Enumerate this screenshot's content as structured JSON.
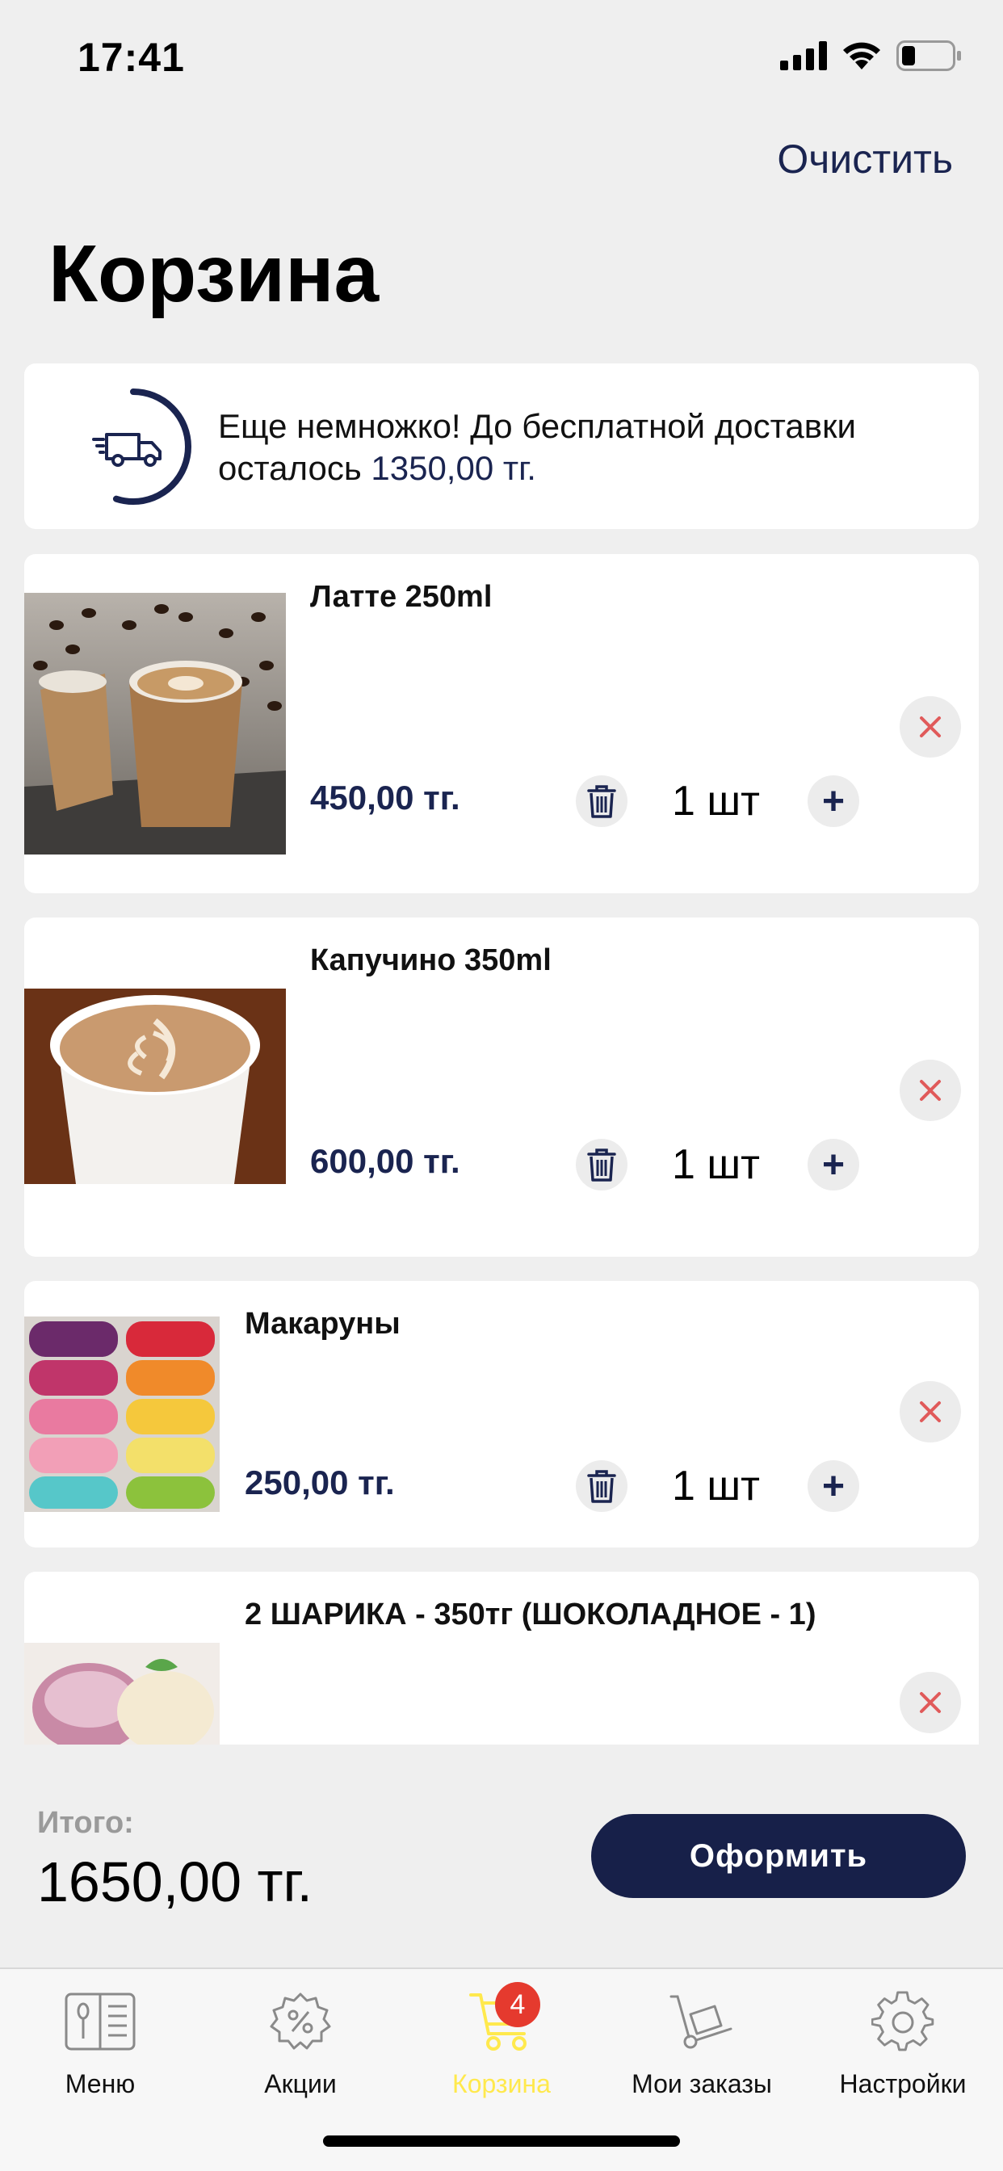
{
  "status_bar": {
    "time": "17:41"
  },
  "header": {
    "clear_label": "Очистить",
    "title": "Корзина"
  },
  "promo": {
    "line1": "Еще немножко! До бесплатной доставки",
    "line2_prefix": "осталось ",
    "amount": "1350,00 тг.",
    "progress_fraction": 0.55
  },
  "cart": {
    "items": [
      {
        "name": "Латте  250ml",
        "price": "450,00 тг.",
        "qty": "1 шт"
      },
      {
        "name": "Капучино  350ml",
        "price": "600,00 тг.",
        "qty": "1 шт"
      },
      {
        "name": "Макаруны",
        "price": "250,00 тг.",
        "qty": "1 шт"
      },
      {
        "name": "2 ШАРИКА - 350тг (ШОКОЛАДНОЕ - 1)"
      }
    ]
  },
  "summary": {
    "total_label": "Итого:",
    "total_value": "1650,00 тг.",
    "checkout_label": "Оформить"
  },
  "tabbar": {
    "tabs": [
      {
        "label": "Меню",
        "icon": "menu-book-icon"
      },
      {
        "label": "Акции",
        "icon": "discount-gear-icon"
      },
      {
        "label": "Корзина",
        "icon": "cart-icon",
        "badge": "4",
        "active": true
      },
      {
        "label": "Мои заказы",
        "icon": "hand-truck-icon"
      },
      {
        "label": "Настройки",
        "icon": "settings-gear-icon"
      }
    ]
  },
  "colors": {
    "accent": "#1a2450",
    "active_tab": "#ffe94d",
    "badge": "#e53a2e",
    "remove_x": "#e05a5a"
  }
}
